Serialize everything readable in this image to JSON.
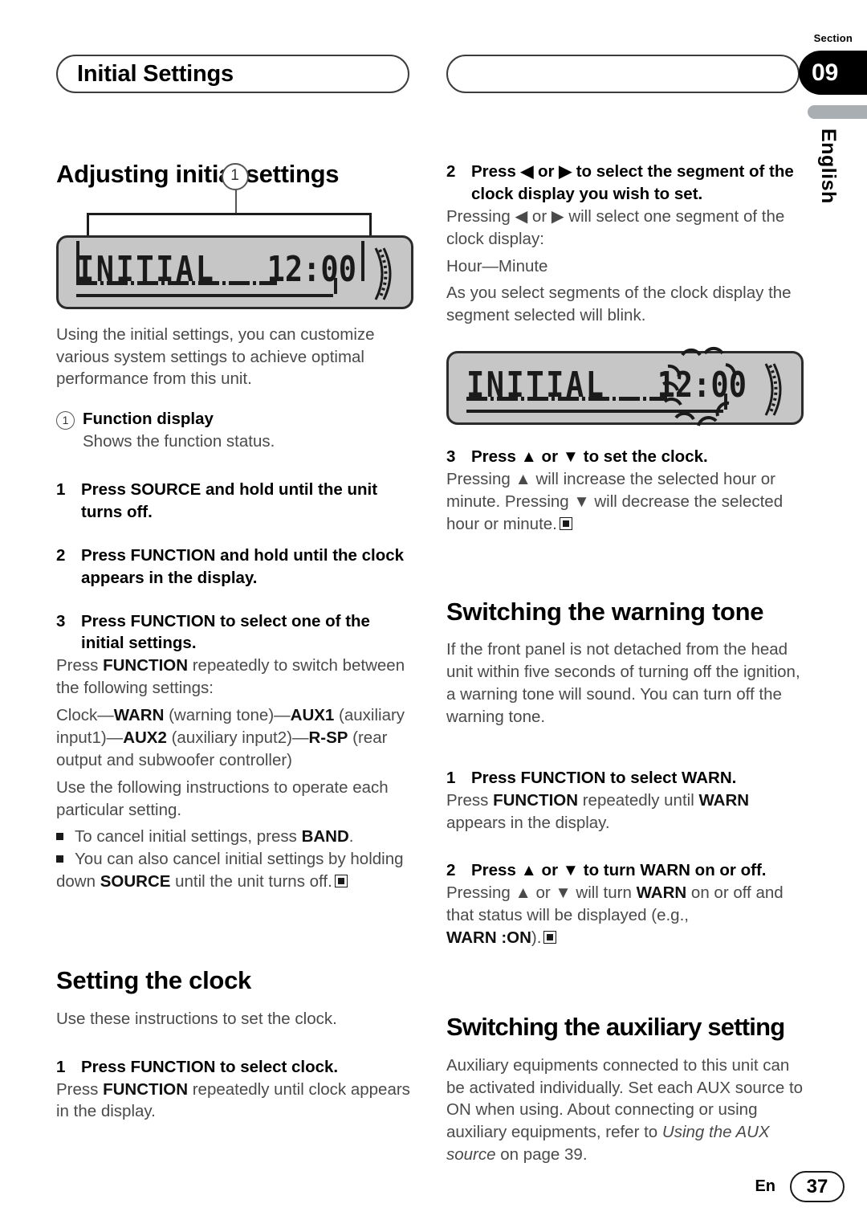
{
  "header": {
    "left_pill_title": "Initial Settings",
    "right_pill_title": "",
    "section_label": "Section",
    "section_number": "09",
    "language_tab": "English"
  },
  "left_column": {
    "heading": "Adjusting initial settings",
    "figure": {
      "callout_number": "1",
      "lcd_text": "INITIAL",
      "lcd_clock": "12:00"
    },
    "intro": "Using the initial settings, you can customize various system settings to achieve optimal performance from this unit.",
    "callout_item": {
      "marker": "1",
      "title": "Function display",
      "description": "Shows the function status."
    },
    "steps": [
      {
        "num": "1",
        "text": "Press SOURCE and hold until the unit turns off."
      },
      {
        "num": "2",
        "text": "Press FUNCTION and hold until the clock appears in the display."
      },
      {
        "num": "3",
        "text": "Press FUNCTION to select one of the initial settings."
      }
    ],
    "step3_body_1": "Press FUNCTION repeatedly to switch between the following settings:",
    "step3_body_1_bold": "FUNCTION",
    "settings_chain": "Clock—WARN (warning tone)—AUX1 (auxiliary input1)—AUX2 (auxiliary input2)—R-SP (rear output and subwoofer controller)",
    "settings_chain_parts": {
      "p1": "Clock—",
      "b1": "WARN",
      "p2": " (warning tone)—",
      "b2": "AUX1",
      "p3": " (auxiliary input1)—",
      "b3": "AUX2",
      "p4": " (auxiliary input2)—",
      "b4": "R-SP",
      "p5": " (rear output and subwoofer controller)"
    },
    "step3_body_2": "Use the following instructions to operate each particular setting.",
    "bullets": [
      {
        "pre": "To cancel initial settings, press ",
        "bold": "BAND",
        "post": "."
      },
      {
        "pre": "You can also cancel initial settings by holding down ",
        "bold": "SOURCE",
        "post": " until the unit turns off."
      }
    ],
    "clock_section": {
      "heading": "Setting the clock",
      "intro": "Use these instructions to set the clock.",
      "step": {
        "num": "1",
        "text": "Press FUNCTION to select clock."
      },
      "step_body_pre": "Press ",
      "step_body_bold": "FUNCTION",
      "step_body_post": " repeatedly until clock appears in the display."
    }
  },
  "right_column": {
    "step2": {
      "num": "2",
      "text_pre": "Press ",
      "arrow_left": "◀",
      "text_mid": " or ",
      "arrow_right": "▶",
      "text_post": " to select the segment of the clock display you wish to set."
    },
    "step2_body": {
      "line1_pre": "Pressing ",
      "line1_arrow_left": "◀",
      "line1_mid": " or ",
      "line1_arrow_right": "▶",
      "line1_post": " will select one segment of the clock display:",
      "line2": "Hour—Minute",
      "line3": "As you select segments of the clock display the segment selected will blink."
    },
    "figure": {
      "lcd_text": "INITIAL",
      "lcd_clock": "12:00"
    },
    "step3": {
      "num": "3",
      "text_pre": "Press ",
      "arrow_up": "▲",
      "text_mid": " or ",
      "arrow_down": "▼",
      "text_post": " to set the clock."
    },
    "step3_body": {
      "pre": "Pressing ",
      "arrow_up": "▲",
      "mid1": " will increase the selected hour or minute. Pressing ",
      "arrow_down": "▼",
      "post": " will decrease the selected hour or minute."
    },
    "warning_section": {
      "heading": "Switching the warning tone",
      "intro": "If the front panel is not detached from the head unit within five seconds of turning off the ignition, a warning tone will sound. You can turn off the warning tone.",
      "step1": {
        "num": "1",
        "text": "Press FUNCTION to select WARN."
      },
      "step1_body": {
        "pre": "Press ",
        "bold1": "FUNCTION",
        "mid": " repeatedly until ",
        "bold2": "WARN",
        "post": " appears in the display."
      },
      "step2": {
        "num": "2",
        "text_pre": "Press ",
        "arrow_up": "▲",
        "text_mid": " or ",
        "arrow_down": "▼",
        "text_post": " to turn WARN on or off."
      },
      "step2_body": {
        "pre": "Pressing ",
        "arrow_up": "▲",
        "mid1": " or ",
        "arrow_down": "▼",
        "mid2": " will turn ",
        "bold": "WARN",
        "post": " on or off and that status will be displayed (e.g.,",
        "status_bold": "WARN :ON",
        "status_post": ")."
      }
    },
    "aux_section": {
      "heading": "Switching the auxiliary setting",
      "body_pre": "Auxiliary equipments connected to this unit can be activated individually. Set each AUX source to ON when using. About connecting or using auxiliary equipments, refer to ",
      "body_italic": "Using the AUX source",
      "body_post": " on page 39."
    }
  },
  "footer": {
    "language": "En",
    "page_number": "37"
  }
}
